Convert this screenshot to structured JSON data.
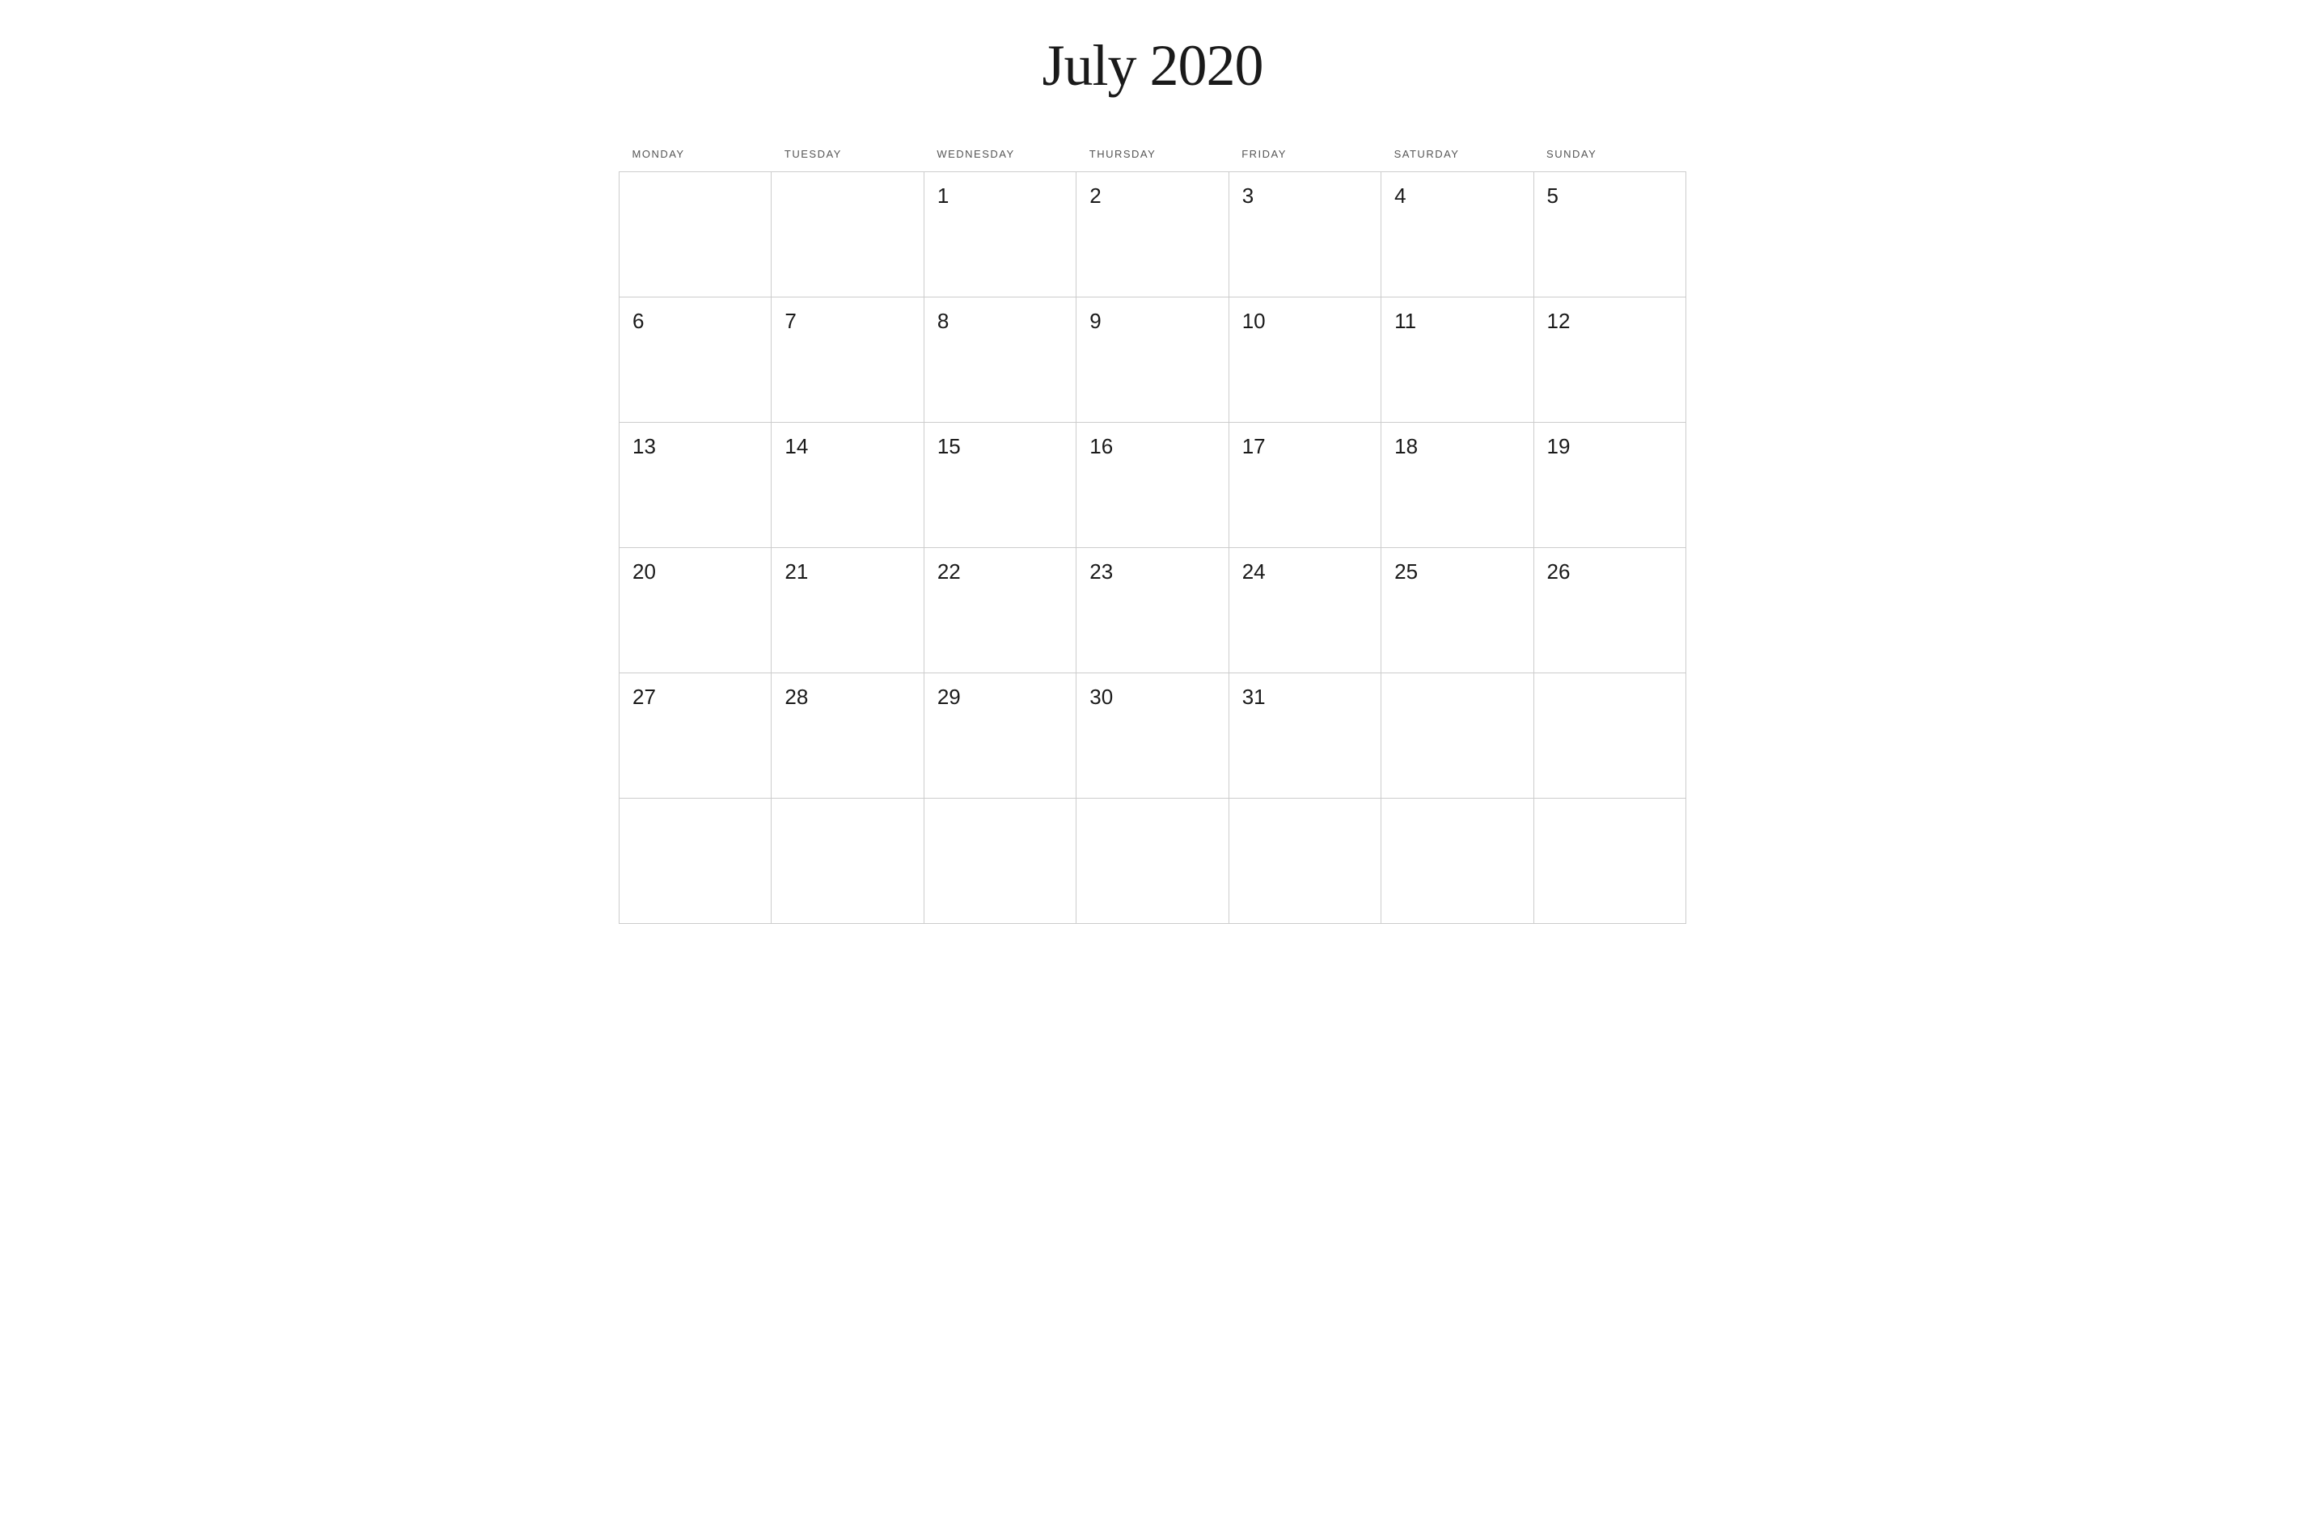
{
  "calendar": {
    "title": "July 2020",
    "headers": [
      "MONDAY",
      "TUESDAY",
      "WEDNESDAY",
      "THURSDAY",
      "FRIDAY",
      "SATURDAY",
      "SUNDAY"
    ],
    "weeks": [
      [
        null,
        null,
        1,
        2,
        3,
        4,
        5
      ],
      [
        6,
        7,
        8,
        9,
        10,
        11,
        12
      ],
      [
        13,
        14,
        15,
        16,
        17,
        18,
        19
      ],
      [
        20,
        21,
        22,
        23,
        24,
        25,
        26
      ],
      [
        27,
        28,
        29,
        30,
        31,
        null,
        null
      ],
      [
        null,
        null,
        null,
        null,
        null,
        null,
        null
      ]
    ]
  }
}
